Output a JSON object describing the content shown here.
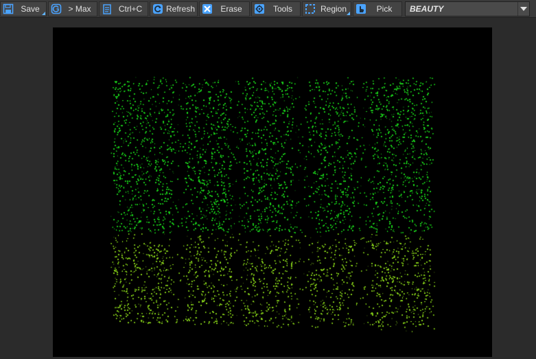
{
  "toolbar": {
    "save_label": "Save",
    "max_label": "> Max",
    "copy_label": "Ctrl+C",
    "refresh_label": "Refresh",
    "erase_label": "Erase",
    "tools_label": "Tools",
    "region_label": "Region",
    "pick_label": "Pick",
    "render_element": "BEAUTY"
  },
  "icons": {
    "save": "save-icon",
    "max": "max-logo-icon",
    "copy": "clipboard-icon",
    "refresh": "refresh-icon",
    "erase": "erase-icon",
    "tools": "gear-icon",
    "region": "region-icon",
    "pick": "hand-pointer-icon",
    "dropdown": "chevron-down-icon"
  },
  "colors": {
    "accent": "#4aa3ff",
    "toolbar_bg": "#3a3a3a",
    "viewport_bg": "#000000",
    "points_top": "#1fd51f",
    "points_bottom": "#8bd61e"
  }
}
